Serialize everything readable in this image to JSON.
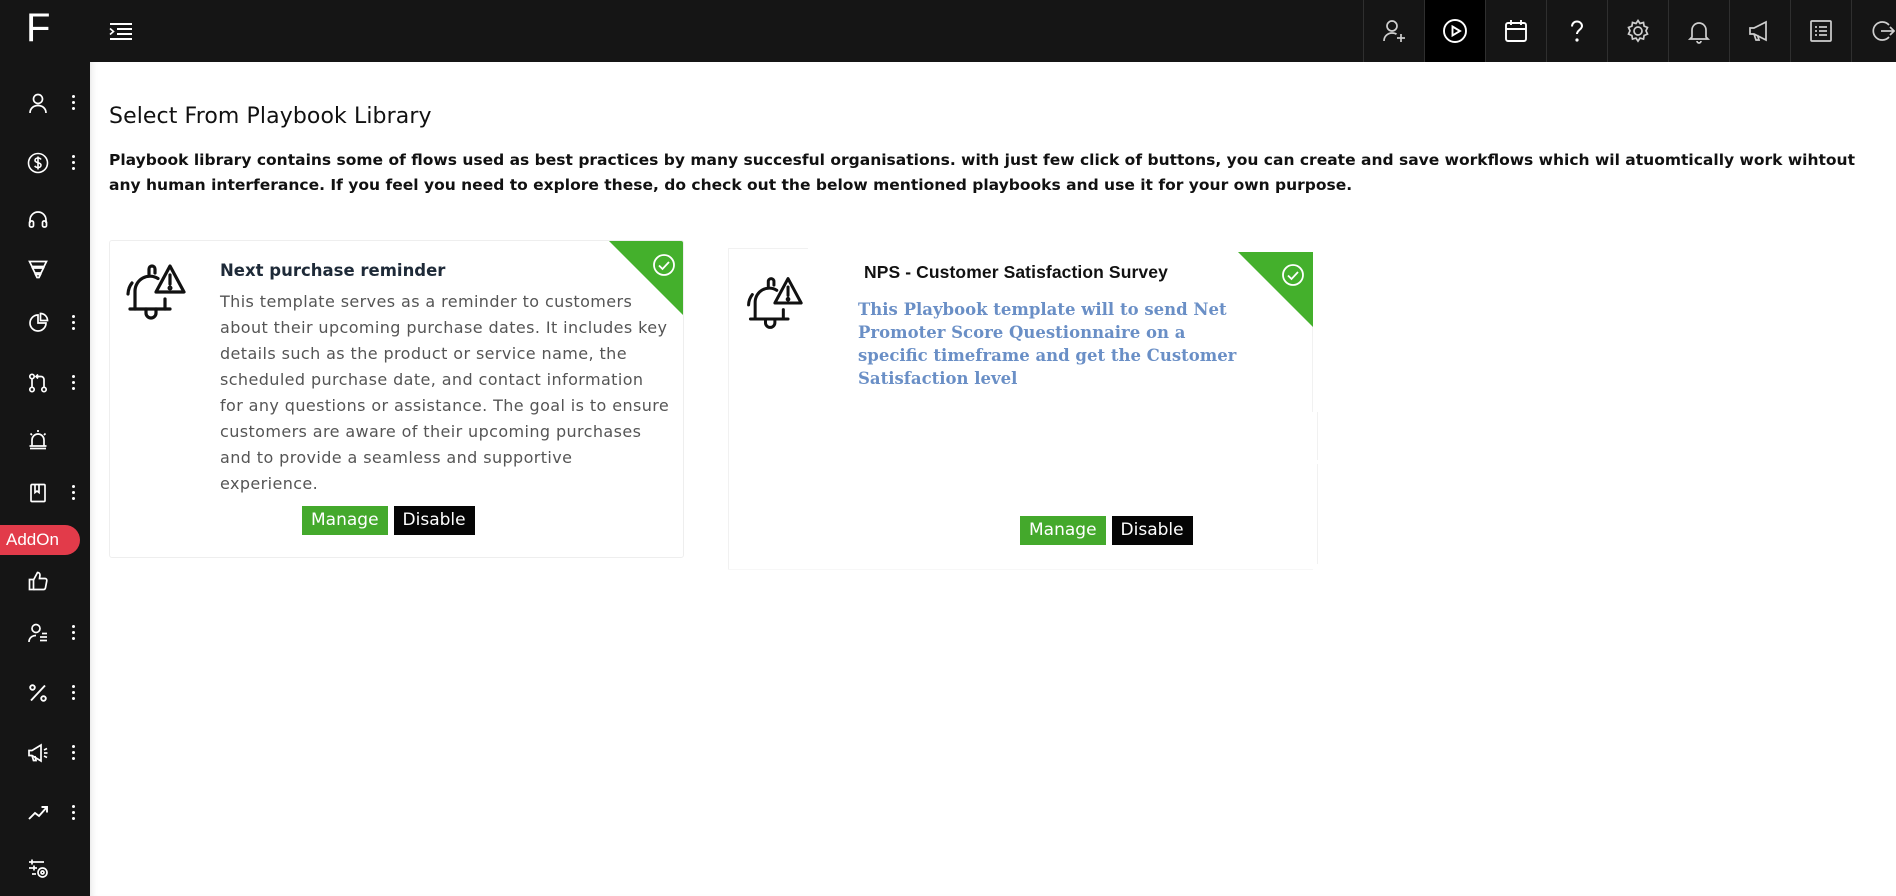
{
  "app": {
    "logo": "F",
    "addon_label": "AddOn"
  },
  "sidebar": {
    "items": [
      {
        "icon": "user-icon",
        "has_menu": true
      },
      {
        "icon": "dollar-circle-icon",
        "has_menu": true
      },
      {
        "icon": "headphones-icon",
        "has_menu": false
      },
      {
        "icon": "funnel-icon",
        "has_menu": false
      },
      {
        "icon": "pie-chart-icon",
        "has_menu": true
      },
      {
        "icon": "git-branch-icon",
        "has_menu": true
      },
      {
        "icon": "alarm-icon",
        "has_menu": false
      },
      {
        "icon": "book-icon",
        "has_menu": true
      },
      {
        "icon": "thumbs-up-icon",
        "has_menu": false
      },
      {
        "icon": "user-list-icon",
        "has_menu": true
      },
      {
        "icon": "percent-icon",
        "has_menu": true
      },
      {
        "icon": "megaphone-icon",
        "has_menu": true
      },
      {
        "icon": "trending-up-icon",
        "has_menu": true
      },
      {
        "icon": "settings-sliders-icon",
        "has_menu": false
      }
    ]
  },
  "topbar": {
    "icons": [
      "add-user-icon",
      "play-circle-icon",
      "calendar-icon",
      "help-icon",
      "gear-icon",
      "bell-icon",
      "megaphone-icon",
      "list-icon",
      "logout-icon"
    ]
  },
  "main": {
    "title": "Select From Playbook Library",
    "description": "Playbook library contains some of flows used as best practices by many succesful organisations. with just few click of buttons, you can create and save workflows which wil atuomtically work wihtout any human interferance. If you feel you need to explore these, do check out the below mentioned playbooks and use it for your own purpose."
  },
  "playbooks": [
    {
      "title": "Next purchase reminder",
      "description": "This template serves as a reminder to customers about their upcoming purchase dates. It includes key details such as the product or service name, the scheduled purchase date, and contact information for any questions or assistance. The goal is to ensure customers are aware of their upcoming purchases and to provide a seamless and supportive experience.",
      "manage_label": "Manage",
      "disable_label": "Disable",
      "status": "enabled"
    },
    {
      "title": "NPS - Customer Satisfaction Survey",
      "description": "This Playbook template will to send Net Promoter Score Questionnaire on a specific timeframe and get the Customer Satisfaction level",
      "manage_label": "Manage",
      "disable_label": "Disable",
      "status": "enabled"
    }
  ],
  "colors": {
    "sidebar_bg": "#151515",
    "accent_green": "#44a92c",
    "addon_red": "#e23b4a",
    "desc_blue": "#6a8fc6"
  }
}
